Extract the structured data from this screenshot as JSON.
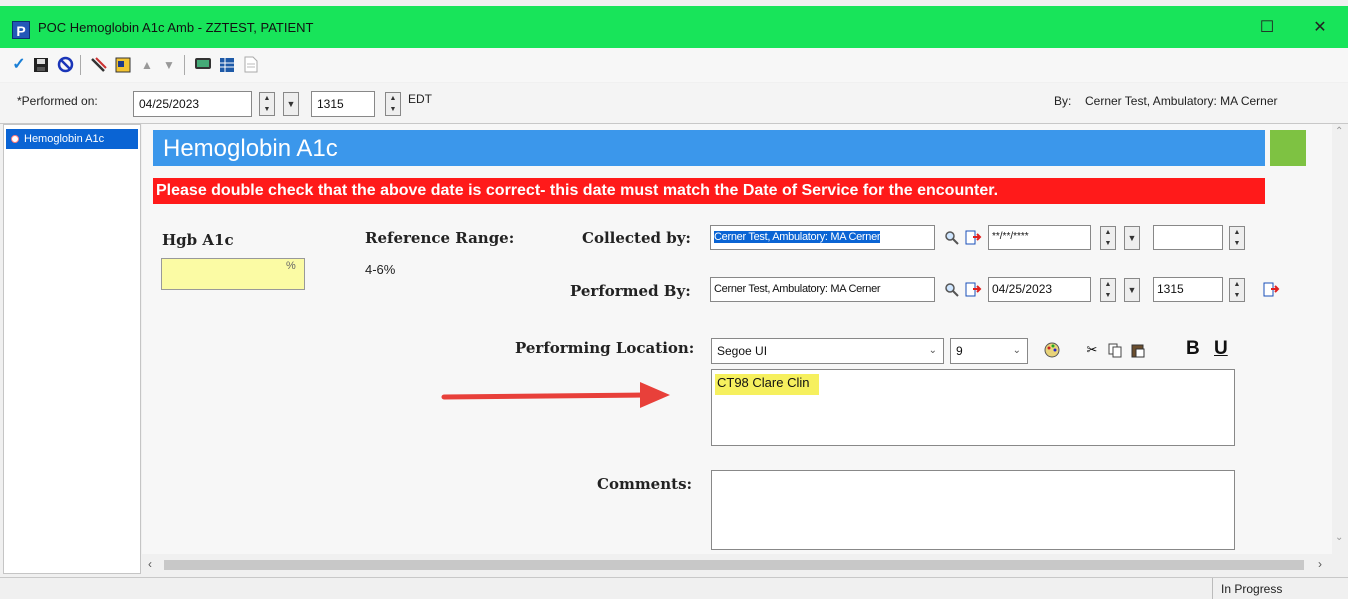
{
  "window": {
    "title": "POC Hemoglobin A1c Amb - ZZTEST, PATIENT",
    "app_icon_letter": "P",
    "maximize_glyph": "☐",
    "close_glyph": "✕"
  },
  "toolbar": {
    "icons": [
      "checkmark-icon",
      "save-icon",
      "cancel-icon",
      "mark-icon",
      "form-browser-icon",
      "up-arrow-icon",
      "down-arrow-icon",
      "monitor-icon",
      "grid-icon",
      "document-icon"
    ]
  },
  "datebar": {
    "performed_on_label": "*Performed on:",
    "date_value": "04/25/2023",
    "time_value": "1315",
    "timezone": "EDT",
    "by_label": "By:",
    "by_value": "Cerner Test, Ambulatory: MA Cerner"
  },
  "nav": {
    "items": [
      {
        "label": "Hemoglobin A1c"
      }
    ]
  },
  "form": {
    "section_title": "Hemoglobin A1c",
    "warning": "Please double check that the above date is correct- this date must match the Date of Service for the encounter.",
    "hgb_label": "Hgb A1c",
    "hgb_value": "",
    "hgb_unit": "%",
    "ref_range_label": "Reference Range:",
    "ref_range_value": "4-6%",
    "collected_by_label": "Collected by:",
    "collected_by_value": "Cerner Test, Ambulatory: MA Cerner",
    "collected_date_placeholder": "**/**/****",
    "collected_time_value": "",
    "performed_by_label": "Performed By:",
    "performed_by_value": "Cerner Test, Ambulatory: MA Cerner",
    "performed_date_value": "04/25/2023",
    "performed_time_value": "1315",
    "performing_location_label": "Performing Location:",
    "font_name": "Segoe UI",
    "font_size": "9",
    "bold_label": "B",
    "underline_label": "U",
    "location_text": "CT98 Clare Clin",
    "comments_label": "Comments:",
    "comments_value": ""
  },
  "status": {
    "text": "In Progress"
  },
  "colors": {
    "titlebar": "#18e45a",
    "header_band": "#3b97eb",
    "warning_bar": "#ff1a1a",
    "selection": "#0a64d4",
    "highlight": "#f6f05e",
    "annotation_arrow": "#e8403a"
  }
}
